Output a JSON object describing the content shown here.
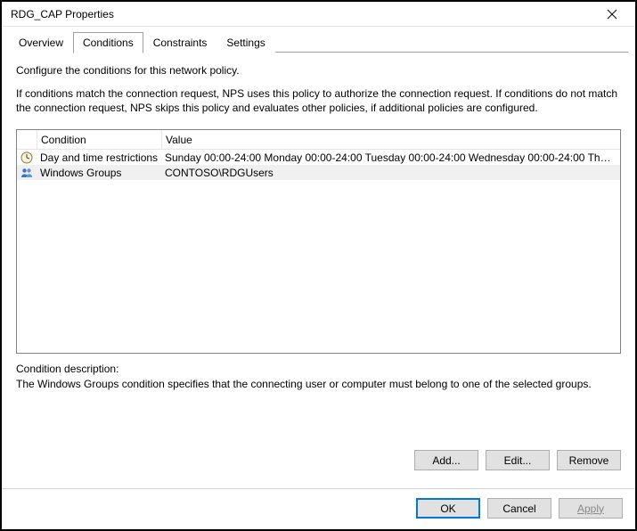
{
  "window": {
    "title": "RDG_CAP Properties"
  },
  "tabs": {
    "overview": "Overview",
    "conditions": "Conditions",
    "constraints": "Constraints",
    "settings": "Settings"
  },
  "body": {
    "intro": "Configure the conditions for this network policy.",
    "explain": "If conditions match the connection request, NPS uses this policy to authorize the connection request. If conditions do not match the connection request, NPS skips this policy and evaluates other policies, if additional policies are configured."
  },
  "list": {
    "header_condition": "Condition",
    "header_value": "Value",
    "rows": [
      {
        "icon": "clock-icon",
        "condition": "Day and time restrictions",
        "value": "Sunday 00:00-24:00 Monday 00:00-24:00 Tuesday 00:00-24:00 Wednesday 00:00-24:00 Thursd..."
      },
      {
        "icon": "group-icon",
        "condition": "Windows Groups",
        "value": "CONTOSO\\RDGUsers"
      }
    ]
  },
  "description": {
    "label": "Condition description:",
    "text": "The Windows Groups condition specifies that the connecting user or computer must belong to one of the selected groups."
  },
  "buttons": {
    "add": "Add...",
    "edit": "Edit...",
    "remove": "Remove",
    "ok": "OK",
    "cancel": "Cancel",
    "apply": "Apply"
  }
}
